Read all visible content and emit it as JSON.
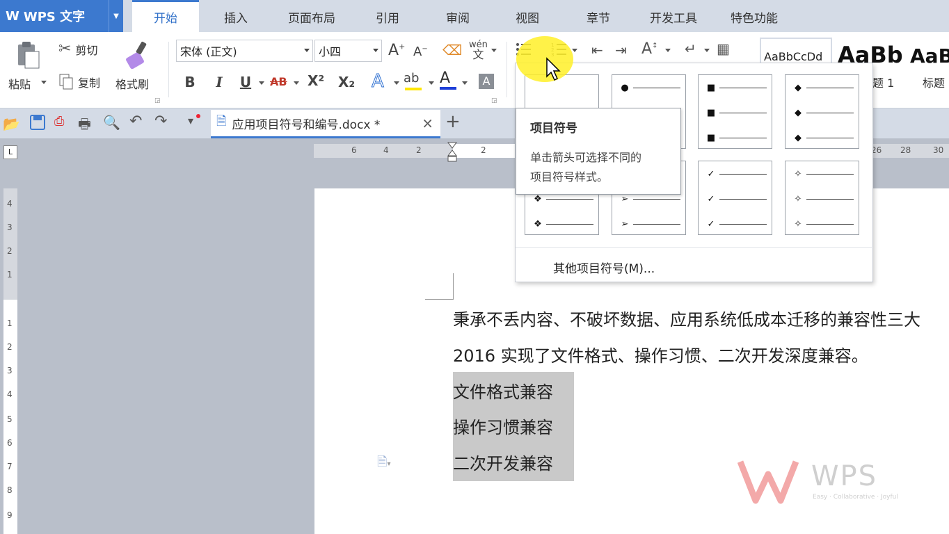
{
  "app": {
    "logo": "W",
    "name": "WPS 文字"
  },
  "tabs": [
    "开始",
    "插入",
    "页面布局",
    "引用",
    "审阅",
    "视图",
    "章节",
    "开发工具",
    "特色功能"
  ],
  "ribbon": {
    "paste": "粘贴",
    "cut": "剪切",
    "copy": "复制",
    "format_painter": "格式刷",
    "font_name": "宋体 (正文)",
    "font_size": "小四",
    "bold": "B",
    "italic": "I",
    "underline": "U",
    "strike": "AB",
    "superscript": "X²",
    "subscript": "X₂",
    "styles": [
      {
        "preview": "AaBbCcDd",
        "label": ""
      },
      {
        "preview": "AaBb",
        "label": "题 1"
      },
      {
        "preview": "AaB",
        "label": "标题"
      }
    ]
  },
  "document_tab": {
    "title": "应用项目符号和编号.docx *",
    "close": "×",
    "new": "+"
  },
  "hruler_numbers": [
    "6",
    "4",
    "2",
    "2",
    "26",
    "28",
    "30"
  ],
  "vruler_numbers": [
    "4",
    "3",
    "2",
    "1",
    "1",
    "2",
    "3",
    "4",
    "5",
    "6",
    "7",
    "8",
    "9"
  ],
  "bullet_menu": {
    "cells": [
      {
        "name": "none",
        "marks": [
          "",
          "",
          ""
        ]
      },
      {
        "name": "dot",
        "marks": [
          "●",
          "",
          ""
        ]
      },
      {
        "name": "square",
        "marks": [
          "■",
          "■",
          "■"
        ]
      },
      {
        "name": "diamond",
        "marks": [
          "◆",
          "◆",
          "◆"
        ]
      },
      {
        "name": "ornate-diamond",
        "marks": [
          "",
          "❖",
          "❖"
        ]
      },
      {
        "name": "arrow",
        "marks": [
          "",
          "➢",
          "➢"
        ]
      },
      {
        "name": "check",
        "marks": [
          "✓",
          "✓",
          "✓"
        ]
      },
      {
        "name": "star",
        "marks": [
          "✧",
          "✧",
          "✧"
        ]
      }
    ],
    "more_label": "其他项目符号(M)..."
  },
  "tooltip": {
    "title": "项目符号",
    "desc_line1": "单击箭头可选择不同的",
    "desc_line2": "项目符号样式。"
  },
  "document": {
    "line1": "秉承不丢内容、不破坏数据、应用系统低成本迁移的兼容性三大",
    "line2": "2016 实现了文件格式、操作习惯、二次开发深度兼容。",
    "items": [
      "文件格式兼容",
      "操作习惯兼容",
      "二次开发兼容"
    ]
  },
  "watermark": {
    "brand": "WPS",
    "tagline": "Easy · Collaborative · Joyful"
  },
  "colors": {
    "accent": "#3c79cf",
    "highlight": "#ffee28",
    "font_color_bar": "#1e3fd8",
    "highlight_bar": "#ffe600"
  }
}
